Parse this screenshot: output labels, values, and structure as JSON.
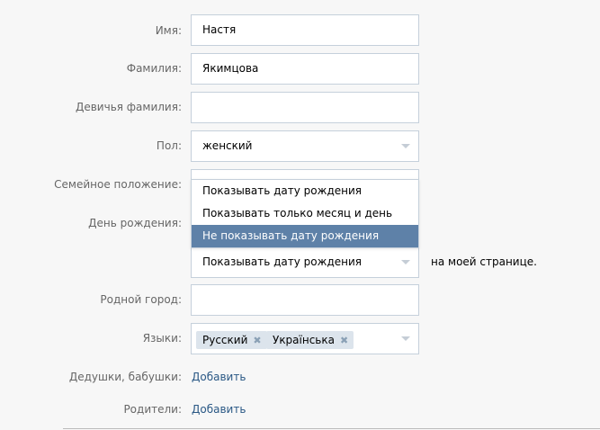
{
  "form": {
    "first_name": {
      "label": "Имя:",
      "value": "Настя"
    },
    "last_name": {
      "label": "Фамилия:",
      "value": "Якимцова"
    },
    "maiden_name": {
      "label": "Девичья фамилия:",
      "value": ""
    },
    "gender": {
      "label": "Пол:",
      "value": "женский"
    },
    "relationship": {
      "label": "Семейное положение:"
    },
    "birthday": {
      "label": "День рождения:",
      "options": [
        "Показывать дату рождения",
        "Показывать только месяц и день",
        "Не показывать дату рождения"
      ],
      "highlighted_index": 2,
      "selected_value": "Показывать дату рождения",
      "suffix": "на моей странице."
    },
    "hometown": {
      "label": "Родной город:",
      "value": ""
    },
    "languages": {
      "label": "Языки:",
      "tags": [
        "Русский",
        "Українська"
      ],
      "remove_glyph": "✖"
    },
    "grandparents": {
      "label": "Дедушки, бабушки:",
      "action": "Добавить"
    },
    "parents": {
      "label": "Родители:",
      "action": "Добавить"
    }
  }
}
